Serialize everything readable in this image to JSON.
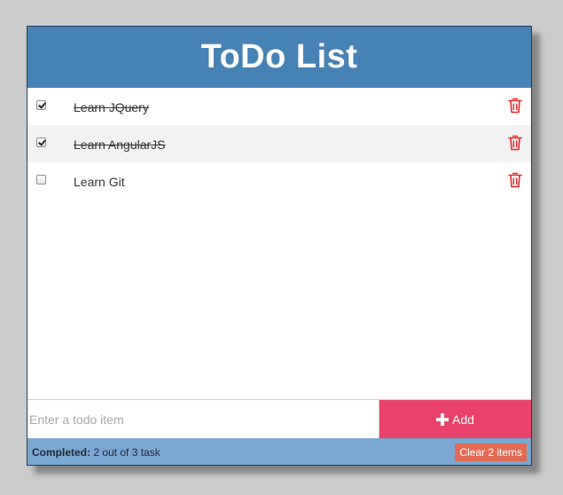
{
  "app": {
    "title": "ToDo List",
    "header_color": "#4682b4",
    "accent_color": "#e8426b"
  },
  "todos": [
    {
      "label": "Learn JQuery",
      "completed": true
    },
    {
      "label": "Learn AngularJS",
      "completed": true
    },
    {
      "label": "Learn Git",
      "completed": false
    }
  ],
  "new_item": {
    "placeholder": "Enter a todo item",
    "value": ""
  },
  "add_button": {
    "label": "Add",
    "icon": "plus-icon"
  },
  "status": {
    "completed_label": "Completed:",
    "completed_text": "2 out of 3 task",
    "completed_count": 2,
    "total_count": 3
  },
  "clear_button": {
    "label": "Clear 2 items"
  },
  "icons": {
    "delete": "trash-icon"
  }
}
